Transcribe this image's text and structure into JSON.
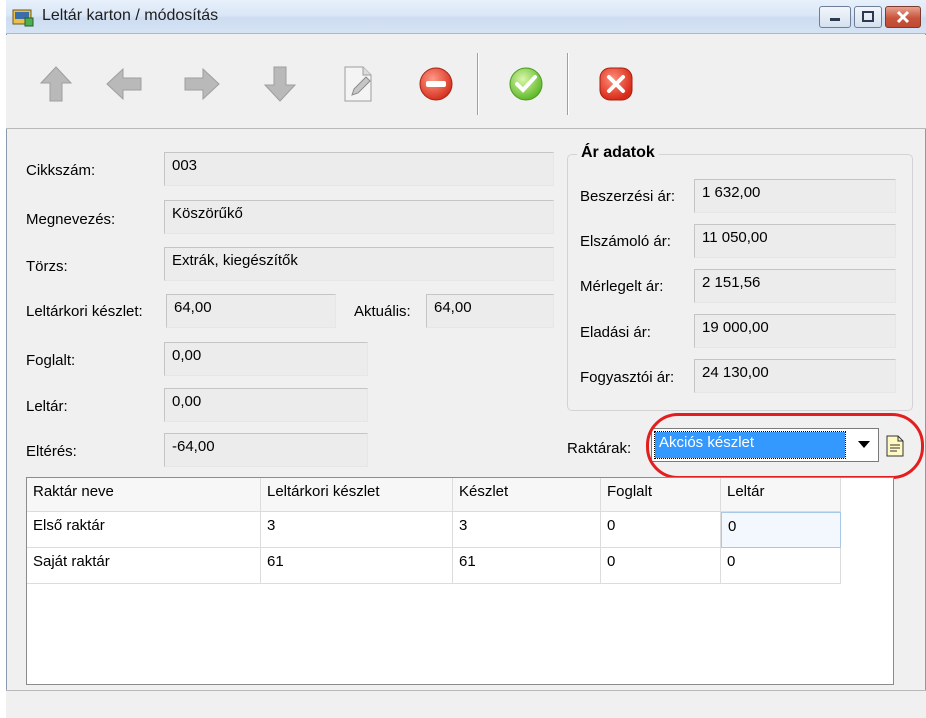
{
  "window": {
    "title": "Leltár karton / módosítás"
  },
  "toolbar": {
    "buttons": [
      {
        "icon": "arrow-up-icon"
      },
      {
        "icon": "arrow-left-icon"
      },
      {
        "icon": "arrow-right-icon"
      },
      {
        "icon": "arrow-down-icon"
      },
      {
        "icon": "edit-document-icon"
      },
      {
        "icon": "remove-icon"
      },
      {
        "icon": "ok-check-icon"
      },
      {
        "icon": "cancel-icon"
      }
    ]
  },
  "form": {
    "cikkszam_label": "Cikkszám:",
    "cikkszam_value": "003",
    "megnevezes_label": "Megnevezés:",
    "megnevezes_value": "Köszörűkő",
    "torzs_label": "Törzs:",
    "torzs_value": "Extrák, kiegészítők",
    "leltarkori_label": "Leltárkori készlet:",
    "leltarkori_value": "64,00",
    "aktualis_label": "Aktuális:",
    "aktualis_value": "64,00",
    "foglalt_label": "Foglalt:",
    "foglalt_value": "0,00",
    "leltar_label": "Leltár:",
    "leltar_value": "0,00",
    "elteres_label": "Eltérés:",
    "elteres_value": "-64,00"
  },
  "prices": {
    "group_title": "Ár adatok",
    "beszerzesi_label": "Beszerzési ár:",
    "beszerzesi_value": "1 632,00",
    "elszamolo_label": "Elszámoló ár:",
    "elszamolo_value": "11 050,00",
    "merlegelt_label": "Mérlegelt ár:",
    "merlegelt_value": "2 151,56",
    "eladasi_label": "Eladási ár:",
    "eladasi_value": "19 000,00",
    "fogyasztoi_label": "Fogyasztói ár:",
    "fogyasztoi_value": "24 130,00"
  },
  "warehouse": {
    "label": "Raktárak:",
    "selected": "Akciós készlet",
    "highlight_color": "#e41e1e"
  },
  "grid": {
    "columns": [
      "Raktár neve",
      "Leltárkori készlet",
      "Készlet",
      "Foglalt",
      "Leltár"
    ],
    "rows": [
      [
        "Első raktár",
        "3",
        "3",
        "0",
        "0"
      ],
      [
        "Saját raktár",
        "61",
        "61",
        "0",
        "0"
      ]
    ]
  }
}
